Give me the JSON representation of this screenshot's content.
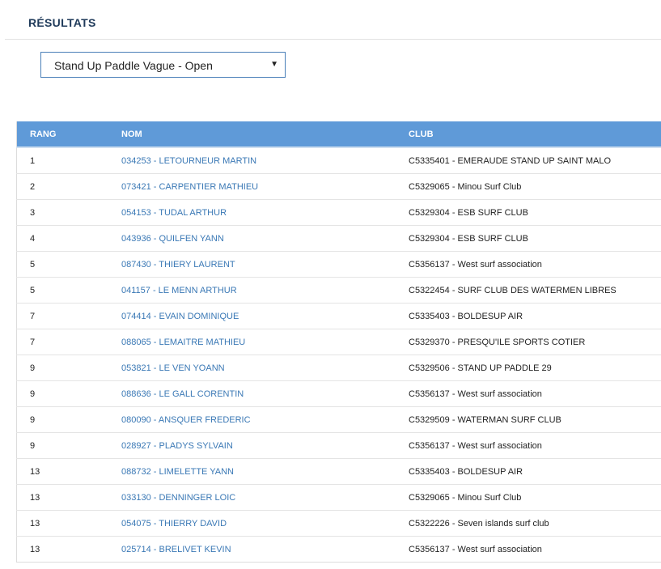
{
  "section": {
    "title": "RÉSULTATS"
  },
  "category_select": {
    "selected": "Stand Up Paddle Vague - Open"
  },
  "table": {
    "headers": {
      "rang": "RANG",
      "nom": "NOM",
      "club": "CLUB"
    },
    "rows": [
      {
        "rang": "1",
        "nom": "034253 - LETOURNEUR MARTIN",
        "club": "C5335401 - EMERAUDE STAND UP SAINT MALO"
      },
      {
        "rang": "2",
        "nom": "073421 - CARPENTIER MATHIEU",
        "club": "C5329065 - Minou Surf Club"
      },
      {
        "rang": "3",
        "nom": "054153 - TUDAL ARTHUR",
        "club": "C5329304 - ESB SURF CLUB"
      },
      {
        "rang": "4",
        "nom": "043936 - QUILFEN YANN",
        "club": "C5329304 - ESB SURF CLUB"
      },
      {
        "rang": "5",
        "nom": "087430 - THIERY LAURENT",
        "club": "C5356137 - West surf association"
      },
      {
        "rang": "5",
        "nom": "041157 - LE MENN ARTHUR",
        "club": "C5322454 - SURF CLUB DES WATERMEN LIBRES"
      },
      {
        "rang": "7",
        "nom": "074414 - EVAIN DOMINIQUE",
        "club": "C5335403 - BOLDESUP AIR"
      },
      {
        "rang": "7",
        "nom": "088065 - LEMAITRE MATHIEU",
        "club": "C5329370 - PRESQU'ILE SPORTS COTIER"
      },
      {
        "rang": "9",
        "nom": "053821 - LE VEN YOANN",
        "club": "C5329506 - STAND UP PADDLE 29"
      },
      {
        "rang": "9",
        "nom": "088636 - LE GALL CORENTIN",
        "club": "C5356137 - West surf association"
      },
      {
        "rang": "9",
        "nom": "080090 - ANSQUER FREDERIC",
        "club": "C5329509 - WATERMAN SURF CLUB"
      },
      {
        "rang": "9",
        "nom": "028927 - PLADYS SYLVAIN",
        "club": "C5356137 - West surf association"
      },
      {
        "rang": "13",
        "nom": "088732 - LIMELETTE YANN",
        "club": "C5335403 - BOLDESUP AIR"
      },
      {
        "rang": "13",
        "nom": "033130 - DENNINGER LOIC",
        "club": "C5329065 - Minou Surf Club"
      },
      {
        "rang": "13",
        "nom": "054075 - THIERRY DAVID",
        "club": "C5322226 - Seven islands surf club"
      },
      {
        "rang": "13",
        "nom": "025714 - BRELIVET KEVIN",
        "club": "C5356137 - West surf association"
      }
    ]
  },
  "colors": {
    "header_bg": "#5f9ad8",
    "link": "#3a78b5",
    "title": "#1f3a5a"
  }
}
